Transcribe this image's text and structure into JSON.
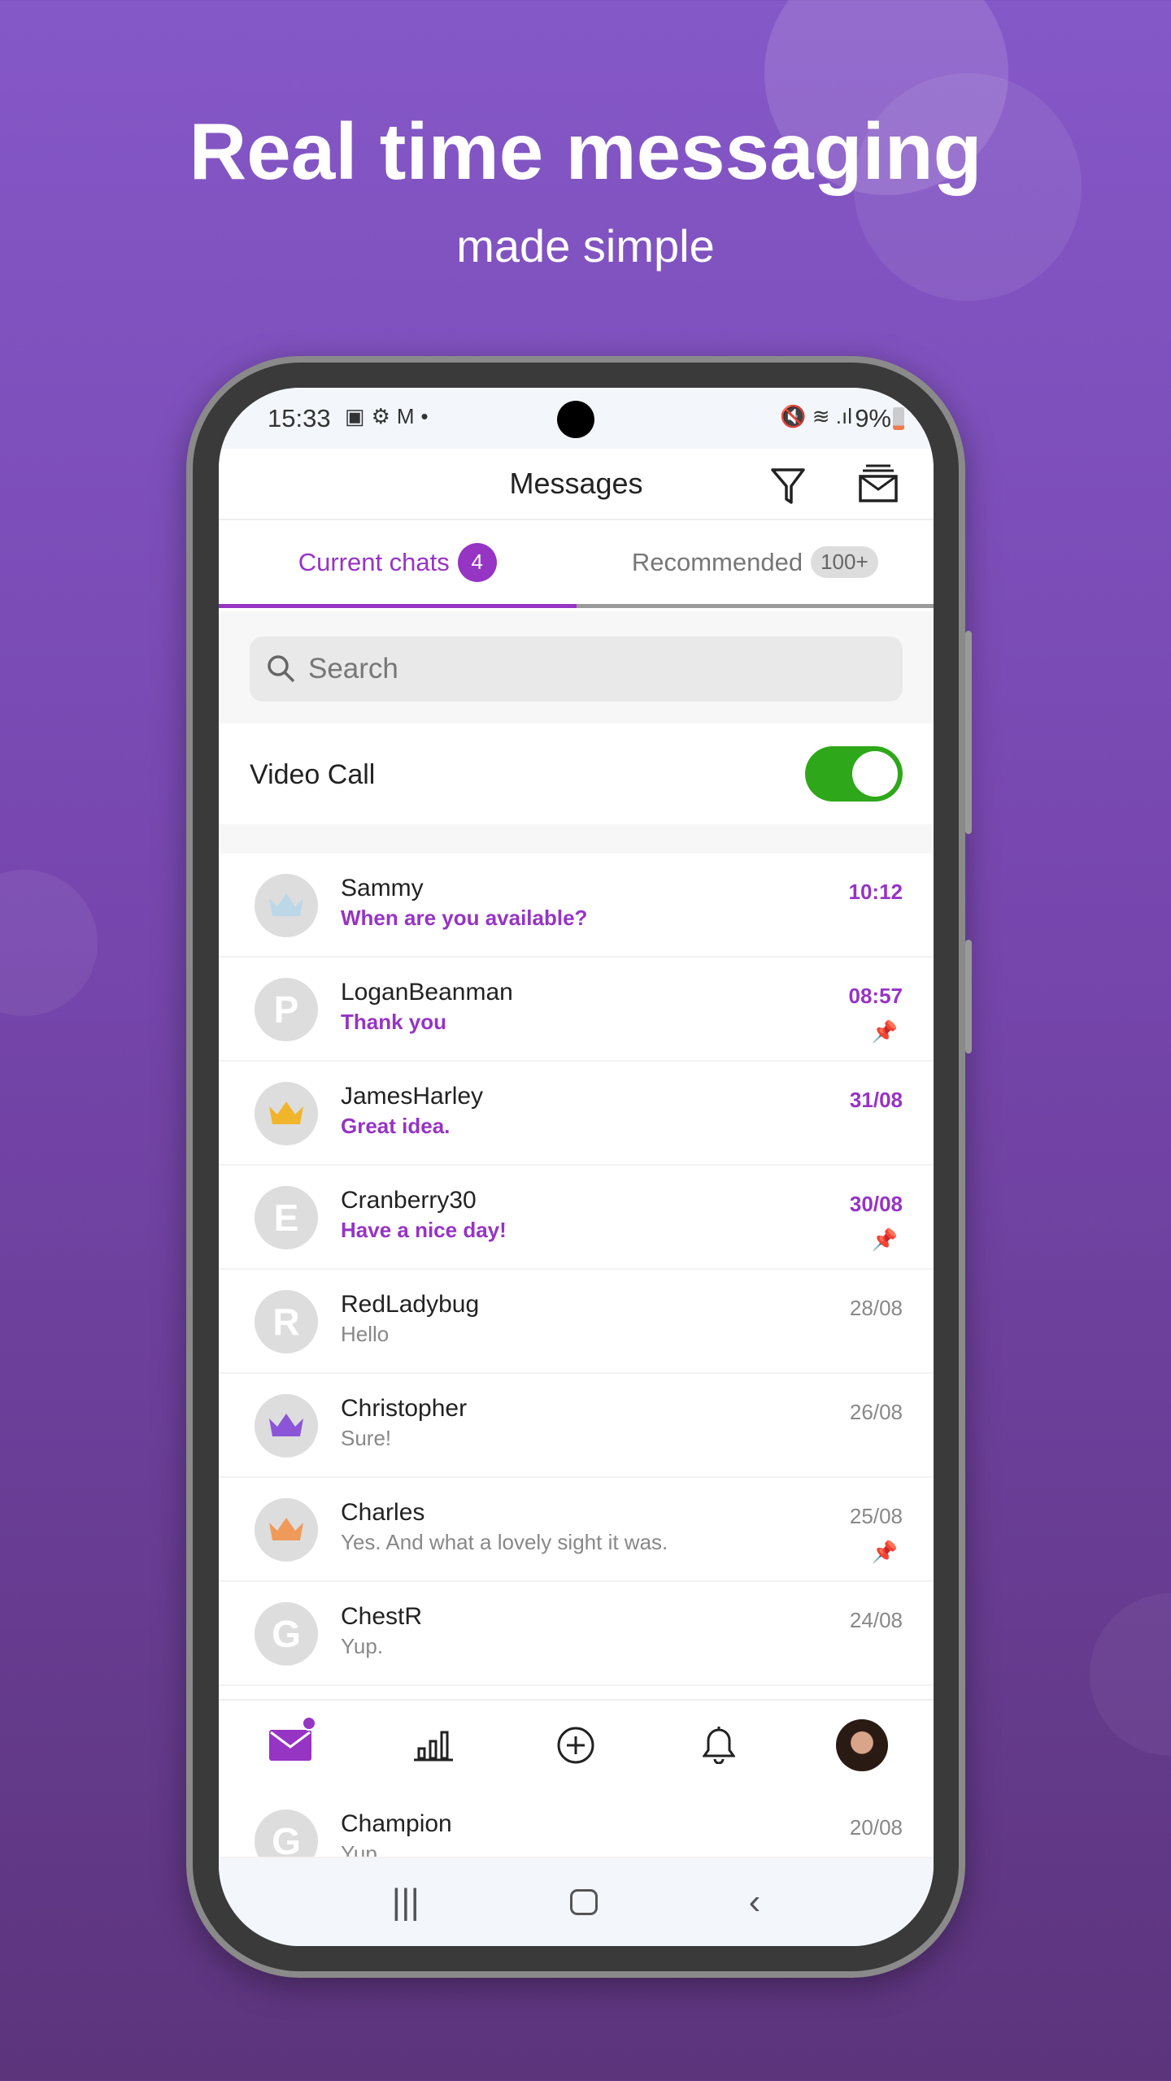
{
  "hero": {
    "title": "Real time messaging",
    "subtitle": "made simple"
  },
  "status_bar": {
    "time": "15:33",
    "battery": "9%"
  },
  "header": {
    "title": "Messages",
    "filter_icon": "filter-icon",
    "inbox_icon": "inbox-icon"
  },
  "tabs": [
    {
      "label": "Current chats",
      "badge": "4",
      "active": true
    },
    {
      "label": "Recommended",
      "badge": "100+",
      "active": false
    }
  ],
  "search": {
    "placeholder": "Search"
  },
  "video_call": {
    "label": "Video Call",
    "enabled": true
  },
  "chats": [
    {
      "name": "Sammy",
      "message": "When are you available?",
      "time": "10:12",
      "unread": true,
      "pinned": false,
      "avatar": "crown-silver"
    },
    {
      "name": "LoganBeanman",
      "message": "Thank you",
      "time": "08:57",
      "unread": true,
      "pinned": true,
      "avatar": "P"
    },
    {
      "name": "JamesHarley",
      "message": "Great idea.",
      "time": "31/08",
      "unread": true,
      "pinned": false,
      "avatar": "crown-gold"
    },
    {
      "name": "Cranberry30",
      "message": "Have a nice day!",
      "time": "30/08",
      "unread": true,
      "pinned": true,
      "avatar": "E"
    },
    {
      "name": "RedLadybug",
      "message": "Hello",
      "time": "28/08",
      "unread": false,
      "pinned": false,
      "avatar": "R"
    },
    {
      "name": "Christopher",
      "message": "Sure!",
      "time": "26/08",
      "unread": false,
      "pinned": false,
      "avatar": "crown-purple"
    },
    {
      "name": "Charles",
      "message": "Yes. And what a lovely sight it was.",
      "time": "25/08",
      "unread": false,
      "pinned": true,
      "avatar": "crown-orange"
    },
    {
      "name": "ChestR",
      "message": "Yup.",
      "time": "24/08",
      "unread": false,
      "pinned": false,
      "avatar": "G"
    },
    {
      "name": "Champion",
      "message": "Yup.",
      "time": "20/08",
      "unread": false,
      "pinned": false,
      "avatar": "G"
    }
  ],
  "bottom_nav": [
    "messages-icon",
    "stats-icon",
    "add-icon",
    "bell-icon",
    "profile-avatar"
  ],
  "colors": {
    "accent": "#9634c4",
    "toggle": "#2ea81a"
  }
}
